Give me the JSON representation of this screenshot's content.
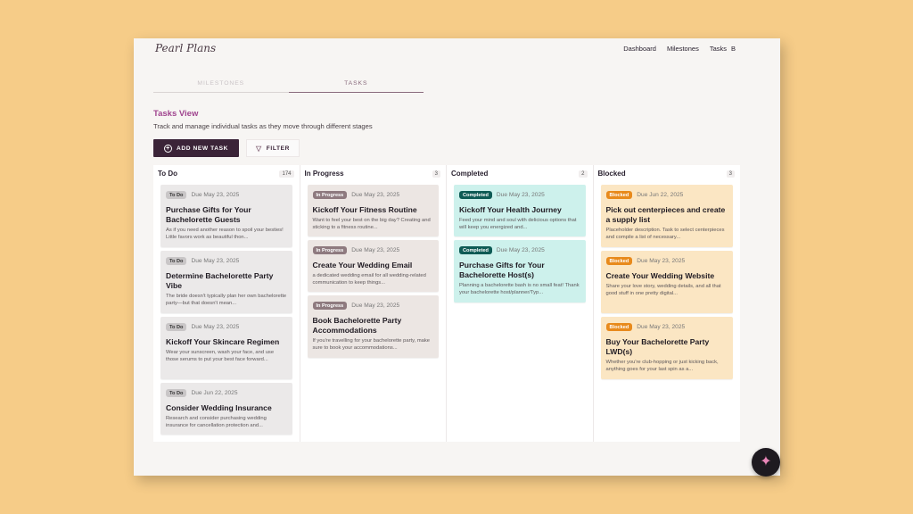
{
  "app": {
    "logo_text": "Pearl Plans"
  },
  "nav": {
    "items": [
      "Dashboard",
      "Milestones",
      "Tasks"
    ],
    "user_initial": "B"
  },
  "view_tabs": [
    {
      "label": "MILESTONES"
    },
    {
      "label": "TASKS"
    }
  ],
  "view": {
    "title": "Tasks View",
    "subtitle": "Track and manage individual tasks as they move through different stages",
    "add_label": "ADD NEW TASK",
    "filter_label": "FILTER"
  },
  "columns": [
    {
      "title": "To Do",
      "count": "174",
      "status": "todo",
      "cards": [
        {
          "badge": "To Do",
          "due": "Due May 23, 2025",
          "title": "Purchase Gifts for Your Bachelorette Guests",
          "desc": "As if you need another reason to spoil your besties! Little favors work as beautiful thon..."
        },
        {
          "badge": "To Do",
          "due": "Due May 23, 2025",
          "title": "Determine Bachelorette Party Vibe",
          "desc": "The bride doesn't typically plan her own bachelorette party—but that doesn't mean..."
        },
        {
          "badge": "To Do",
          "due": "Due May 23, 2025",
          "title": "Kickoff Your Skincare Regimen",
          "desc": "Wear your sunscreen, wash your face, and use those serums to put your best face forward..."
        },
        {
          "badge": "To Do",
          "due": "Due Jun 22, 2025",
          "title": "Consider Wedding Insurance",
          "desc": "Research and consider purchasing wedding insurance for cancellation protection and..."
        }
      ]
    },
    {
      "title": "In Progress",
      "count": "3",
      "status": "inprog",
      "cards": [
        {
          "badge": "In Progress",
          "due": "Due May 23, 2025",
          "title": "Kickoff Your Fitness Routine",
          "desc": "Want to feel your best on the big day? Creating and sticking to a fitness routine..."
        },
        {
          "badge": "In Progress",
          "due": "Due May 23, 2025",
          "title": "Create Your Wedding Email",
          "desc": "a dedicated wedding email for all wedding-related communication to keep things..."
        },
        {
          "badge": "In Progress",
          "due": "Due May 23, 2025",
          "title": "Book Bachelorette Party Accommodations",
          "desc": "If you're travelling for your bachelorette party, make sure to book your accommodations..."
        }
      ]
    },
    {
      "title": "Completed",
      "count": "2",
      "status": "done",
      "cards": [
        {
          "badge": "Completed",
          "due": "Due May 23, 2025",
          "title": "Kickoff Your Health Journey",
          "desc": "Feed your mind and soul with delicious options that will keep you energized and..."
        },
        {
          "badge": "Completed",
          "due": "Due May 23, 2025",
          "title": "Purchase Gifts for Your Bachelorette Host(s)",
          "desc": "Planning a bachelorette bash is no small feat! Thank your bachelorette host/planner/Typ..."
        }
      ]
    },
    {
      "title": "Blocked",
      "count": "3",
      "status": "blocked",
      "cards": [
        {
          "badge": "Blocked",
          "due": "Due Jun 22, 2025",
          "title": "Pick out centerpieces and create a supply list",
          "desc": "Placeholder description. Task to select centerpieces and compile a list of necessary..."
        },
        {
          "badge": "Blocked",
          "due": "Due May 23, 2025",
          "title": "Create Your Wedding Website",
          "desc": "Share your love story, wedding details, and all that good stuff in one pretty digital..."
        },
        {
          "badge": "Blocked",
          "due": "Due May 23, 2025",
          "title": "Buy Your Bachelorette Party LWD(s)",
          "desc": "Whether you're club-hopping or just kicking back, anything goes for your last spin as a..."
        }
      ]
    }
  ],
  "colors": {
    "accent": "#a0458f",
    "primary": "#3b2438",
    "todo": "#ebe9e9",
    "in_progress": "#ece6e3",
    "completed": "#cdf1ec",
    "blocked": "#fbe6c3"
  },
  "icons": {
    "add": "plus-circle-icon",
    "filter": "filter-icon",
    "fab": "sparkle-icon"
  }
}
